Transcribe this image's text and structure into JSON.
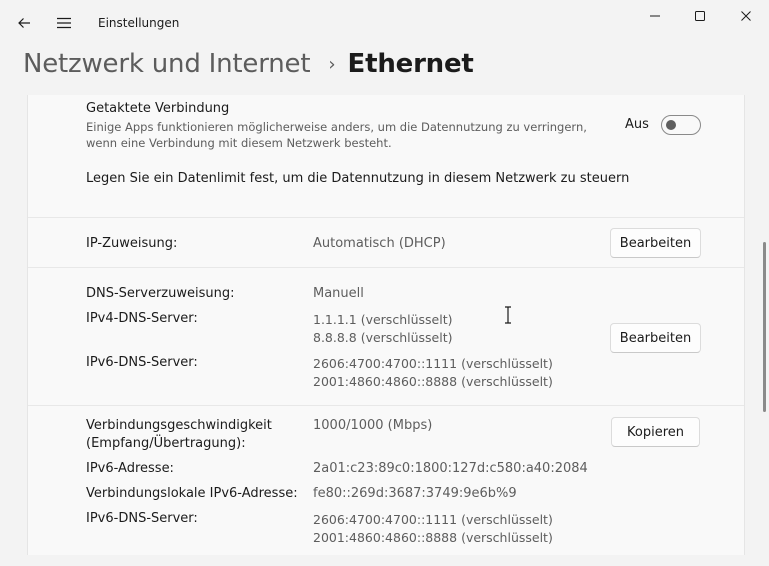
{
  "window": {
    "app_title": "Einstellungen",
    "icons": {
      "back": "back-arrow-icon",
      "menu": "hamburger-menu-icon",
      "minimize": "minimize-icon",
      "maximize": "maximize-icon",
      "close": "close-icon"
    }
  },
  "header": {
    "parent": "Netzwerk und Internet",
    "separator": "›",
    "current": "Ethernet"
  },
  "metered": {
    "title": "Getaktete Verbindung",
    "description": "Einige Apps funktionieren möglicherweise anders, um die Datennutzung zu verringern, wenn eine Verbindung mit diesem Netzwerk besteht.",
    "toggle_state": "Aus",
    "data_limit_link": "Legen Sie ein Datenlimit fest, um die Datennutzung in diesem Netzwerk zu steuern"
  },
  "ip_assignment": {
    "label": "IP-Zuweisung:",
    "value": "Automatisch (DHCP)",
    "button": "Bearbeiten"
  },
  "dns": {
    "assignment_label": "DNS-Serverzuweisung:",
    "assignment_value": "Manuell",
    "ipv4_label": "IPv4-DNS-Server:",
    "ipv4_values": [
      "1.1.1.1 (verschlüsselt)",
      "8.8.8.8 (verschlüsselt)"
    ],
    "ipv6_label": "IPv6-DNS-Server:",
    "ipv6_values": [
      "2606:4700:4700::1111 (verschlüsselt)",
      "2001:4860:4860::8888 (verschlüsselt)"
    ],
    "button": "Bearbeiten"
  },
  "properties": {
    "speed_label_1": "Verbindungsgeschwindigkeit",
    "speed_label_2": "(Empfang/Übertragung):",
    "speed_value": "1000/1000 (Mbps)",
    "button": "Kopieren",
    "ipv6_address_label": "IPv6-Adresse:",
    "ipv6_address_value": "2a01:c23:89c0:1800:127d:c580:a40:2084",
    "link_local_label": "Verbindungslokale IPv6-Adresse:",
    "link_local_value": "fe80::269d:3687:3749:9e6b%9",
    "ipv6_dns_label": "IPv6-DNS-Server:",
    "ipv6_dns_values": [
      "2606:4700:4700::1111 (verschlüsselt)",
      "2001:4860:4860::8888 (verschlüsselt)"
    ]
  }
}
